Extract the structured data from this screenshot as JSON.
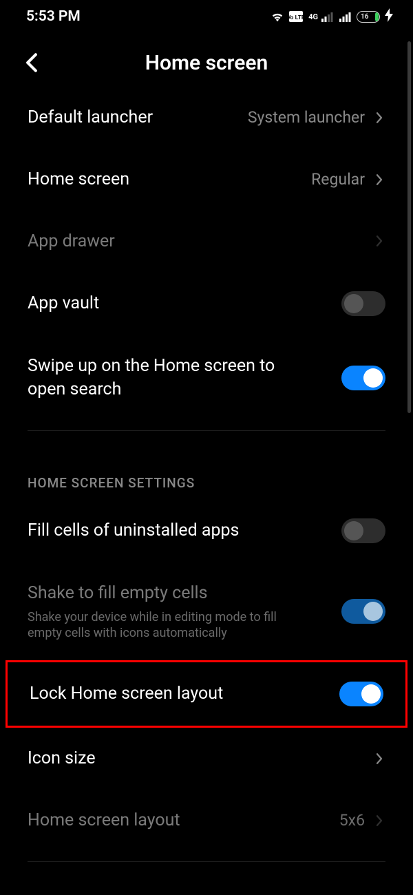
{
  "statusbar": {
    "time": "5:53 PM",
    "network_label": "4G",
    "battery_pct": "16"
  },
  "header": {
    "title": "Home screen"
  },
  "rows": {
    "default_launcher": {
      "label": "Default launcher",
      "value": "System launcher"
    },
    "home_screen": {
      "label": "Home screen",
      "value": "Regular"
    },
    "app_drawer": {
      "label": "App drawer"
    },
    "app_vault": {
      "label": "App vault"
    },
    "swipe_search": {
      "label": "Swipe up on the Home screen to open search"
    },
    "section_label": "HOME SCREEN SETTINGS",
    "fill_cells": {
      "label": "Fill cells of uninstalled apps"
    },
    "shake_fill": {
      "label": "Shake to fill empty cells",
      "sub": "Shake your device while in editing mode to fill empty cells with icons automatically"
    },
    "lock_layout": {
      "label": "Lock Home screen layout"
    },
    "icon_size": {
      "label": "Icon size"
    },
    "layout": {
      "label": "Home screen layout",
      "value": "5x6"
    }
  }
}
